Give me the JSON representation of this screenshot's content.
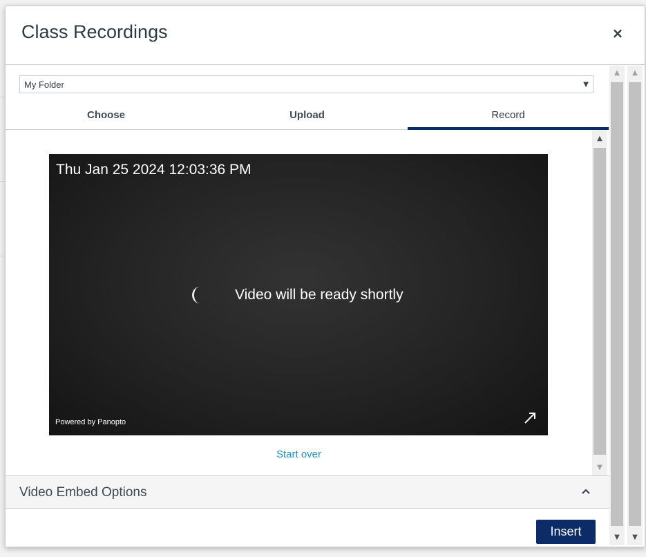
{
  "modal": {
    "title": "Class Recordings",
    "close_label": "×"
  },
  "folder_select": {
    "value": "My Folder"
  },
  "tabs": [
    {
      "label": "Choose",
      "active": false
    },
    {
      "label": "Upload",
      "active": false
    },
    {
      "label": "Record",
      "active": true
    }
  ],
  "video": {
    "timestamp": "Thu Jan 25 2024 12:03:36 PM",
    "status": "Video will be ready shortly",
    "powered_by": "Powered by Panopto"
  },
  "start_over_label": "Start over",
  "embed_options": {
    "label": "Video Embed Options"
  },
  "insert_label": "Insert",
  "colors": {
    "accent": "#0c2c68",
    "link": "#1c91c9"
  }
}
